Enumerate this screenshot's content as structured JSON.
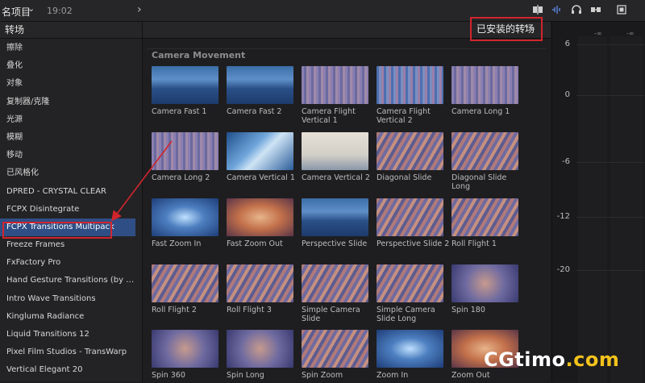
{
  "topbar": {
    "project": "名项目",
    "chevron": "⌄",
    "time": "19:02",
    "forward": "›"
  },
  "sidebar": {
    "header": "转场",
    "items": [
      {
        "label": "擦除"
      },
      {
        "label": "叠化"
      },
      {
        "label": "对象"
      },
      {
        "label": "复制器/克隆"
      },
      {
        "label": "光源"
      },
      {
        "label": "模糊"
      },
      {
        "label": "移动"
      },
      {
        "label": "已风格化"
      },
      {
        "label": "DPRED - CRYSTAL CLEAR"
      },
      {
        "label": "FCPX Disintegrate"
      },
      {
        "label": "FCPX Transitions Multipack"
      },
      {
        "label": "Freeze Frames"
      },
      {
        "label": "FxFactory Pro"
      },
      {
        "label": "Hand Gesture Transitions (by LLm..."
      },
      {
        "label": "Intro Wave Transitions"
      },
      {
        "label": "Kingluma Radiance"
      },
      {
        "label": "Liquid Transitions 12"
      },
      {
        "label": "Pixel Film Studios - TransWarp"
      },
      {
        "label": "Vertical Elegant 20"
      }
    ],
    "selected_index": 10
  },
  "browser": {
    "filter_label": "已安装的转场",
    "filter_icon": "⌃⌄",
    "category": "Camera Movement",
    "tiles": [
      {
        "label": "Camera Fast 1",
        "style": "blue-mountain"
      },
      {
        "label": "Camera Fast 2",
        "style": "blue-mountain"
      },
      {
        "label": "Camera Flight Vertical 1",
        "style": "blur-purple"
      },
      {
        "label": "Camera Flight Vertical 2",
        "style": "blur-blue"
      },
      {
        "label": "Camera Long 1",
        "style": "blur-purple"
      },
      {
        "label": "Camera Long 2",
        "style": "blur-purple"
      },
      {
        "label": "Camera Vertical 1",
        "style": "diag-blue"
      },
      {
        "label": "Camera Vertical 2",
        "style": "light"
      },
      {
        "label": "Diagonal Slide",
        "style": "blur-warm"
      },
      {
        "label": "Diagonal Slide Long",
        "style": "blur-warm"
      },
      {
        "label": "Fast Zoom In",
        "style": "zoom-blue"
      },
      {
        "label": "Fast Zoom Out",
        "style": "zoom-orange"
      },
      {
        "label": "Perspective Slide",
        "style": "blue-mountain"
      },
      {
        "label": "Perspective Slide 2",
        "style": "blur-warm"
      },
      {
        "label": "Roll Flight 1",
        "style": "blur-warm"
      },
      {
        "label": "Roll Flight 2",
        "style": "blur-warm"
      },
      {
        "label": "Roll Flight 3",
        "style": "blur-warm"
      },
      {
        "label": "Simple Camera Slide",
        "style": "blur-warm"
      },
      {
        "label": "Simple Camera Slide Long",
        "style": "blur-warm"
      },
      {
        "label": "Spin 180",
        "style": "spin"
      },
      {
        "label": "Spin 360",
        "style": "spin"
      },
      {
        "label": "Spin Long",
        "style": "spin"
      },
      {
        "label": "Spin Zoom",
        "style": "blur-warm"
      },
      {
        "label": "Zoom In",
        "style": "zoom-blue"
      },
      {
        "label": "Zoom Out",
        "style": "zoom-orange"
      }
    ]
  },
  "meter": {
    "top_labels": [
      "-∞",
      "-∞"
    ],
    "scale": [
      "6",
      "0",
      "-6",
      "-12",
      "-20"
    ]
  },
  "watermark": {
    "part1": "CGtimo",
    "part2": ".com"
  },
  "colors": {
    "accent_selected": "#2f4e86",
    "highlight_red": "#d0252d",
    "watermark_yellow": "#f3c21c"
  }
}
